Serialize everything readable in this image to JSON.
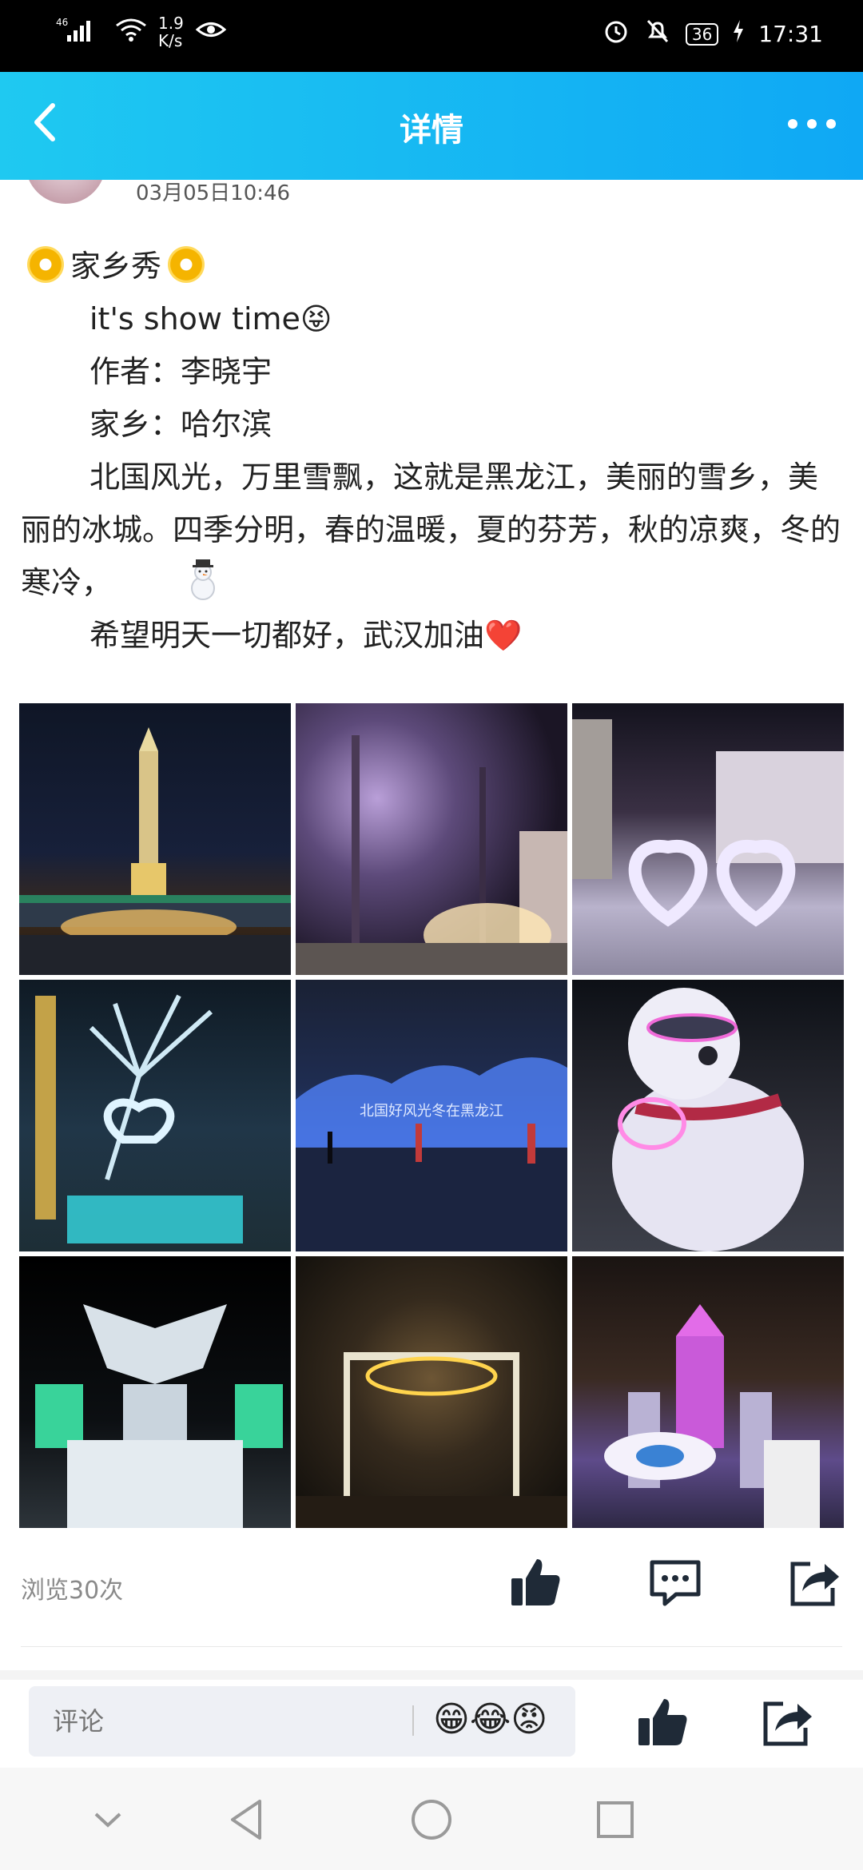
{
  "status_bar": {
    "signal": "46",
    "net_speed": "1.9",
    "net_unit": "K/s",
    "battery": "36",
    "time": "17:31"
  },
  "header": {
    "title": "详情"
  },
  "post": {
    "time": "03月05日10:46",
    "lines": [
      "家乡秀",
      "it's show time😝",
      "作者：李晓宇",
      "家乡：哈尔滨",
      "北国风光，万里雪飘，这就是黑龙江，美丽的雪乡，美丽的冰城。四季分明，春的温暖，夏的芬芳，秋的凉爽，冬的寒冷，",
      "希望明天一切都好，武汉加油",
      "❤️"
    ],
    "photo_caption": "北国好风光冬在黑龙江",
    "views": "浏览30次"
  },
  "bottom_bar": {
    "comment_placeholder": "评论",
    "emojis": "😁😂😡"
  },
  "colors": {
    "title_bar_start": "#1fc9f1",
    "title_bar_end": "#0fa8f4",
    "icon_dark": "#1f2a37"
  }
}
